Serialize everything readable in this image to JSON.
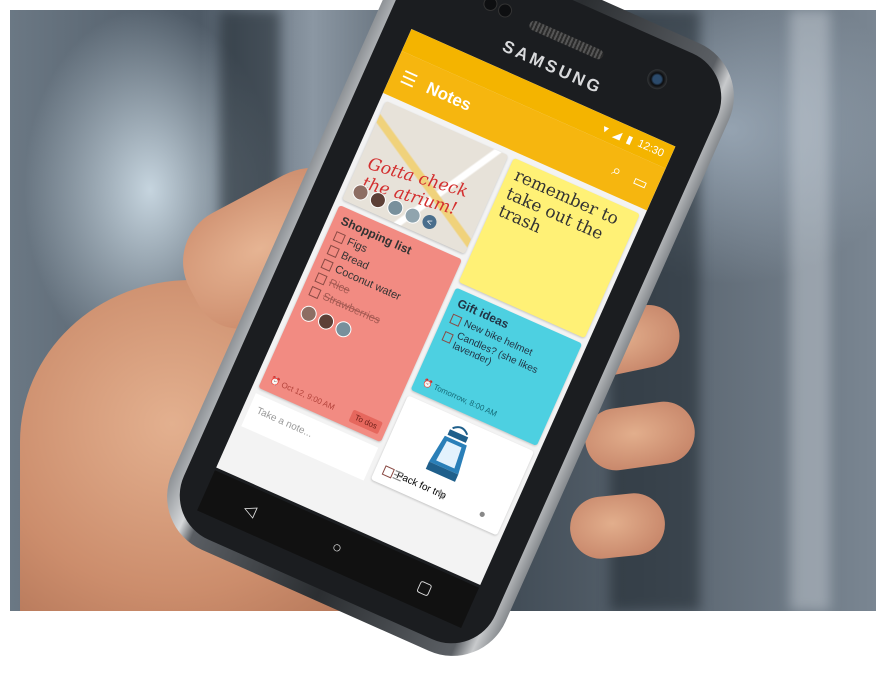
{
  "phone": {
    "brand": "SAMSUNG",
    "status_time": "12:30"
  },
  "app": {
    "title": "Notes",
    "menu_icon": "menu-icon",
    "search_icon": "search-icon",
    "view_icon": "view-toggle-icon",
    "accent_color": "#f6b60f"
  },
  "notes": {
    "map_note": {
      "scribble": "Gotta check the atrium!"
    },
    "yellow_note": {
      "text": "remember to take out the trash",
      "color": "#fff176"
    },
    "shopping": {
      "title": "Shopping list",
      "items": [
        "Figs",
        "Bread",
        "Coconut water"
      ],
      "done_items": [
        "Rice",
        "Strawberries"
      ],
      "reminder": "Oct 12, 9:00 AM",
      "label": "To dos",
      "color": "#f28b82"
    },
    "gift": {
      "title": "Gift ideas",
      "items": [
        "New bike helmet",
        "Candles? (she likes lavender)"
      ],
      "reminder": "Tomorrow, 8:00 AM",
      "color": "#4dd0e1"
    },
    "trip": {
      "item": "Pack for trip"
    }
  },
  "composer": {
    "placeholder": "Take a note..."
  }
}
